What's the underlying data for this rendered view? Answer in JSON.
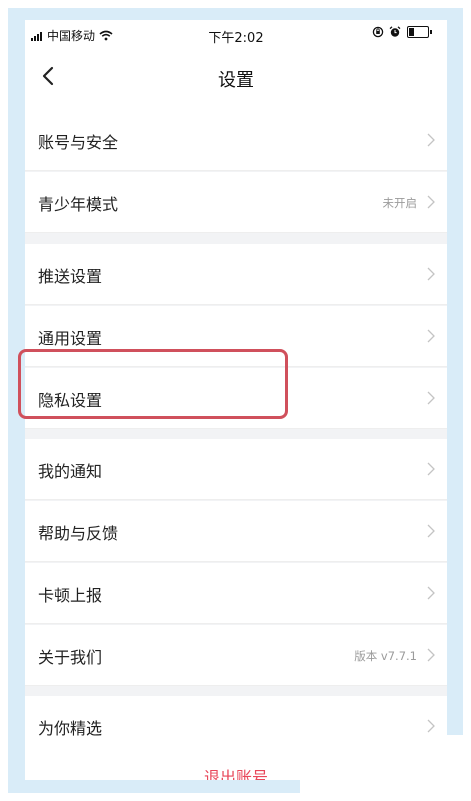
{
  "status_bar": {
    "carrier": "中国移动",
    "time": "下午2:02"
  },
  "nav": {
    "title": "设置",
    "back_icon": "chevron-left-icon"
  },
  "settings": {
    "account_security": "账号与安全",
    "youth_mode": "青少年模式",
    "youth_mode_status": "未开启",
    "push_settings": "推送设置",
    "general_settings": "通用设置",
    "privacy_settings": "隐私设置",
    "my_notifications": "我的通知",
    "help_feedback": "帮助与反馈",
    "lag_report": "卡顿上报",
    "about_us": "关于我们",
    "version": "版本 v7.7.1",
    "picks_for_you": "为你精选"
  },
  "logout_label": "退出账号",
  "colors": {
    "accent_red": "#e8475a",
    "highlight_border": "#d0505c"
  }
}
